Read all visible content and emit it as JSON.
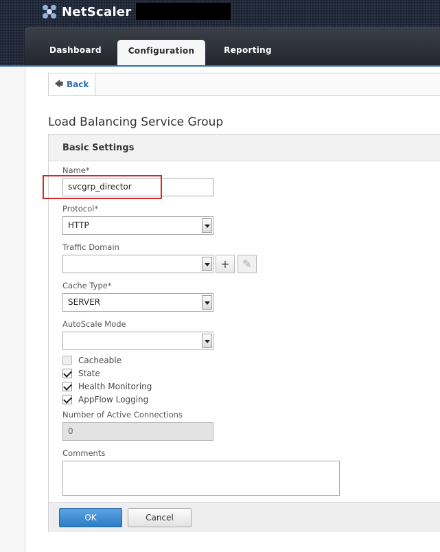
{
  "header": {
    "brand": "NetScaler",
    "tabs": [
      {
        "label": "Dashboard",
        "active": false
      },
      {
        "label": "Configuration",
        "active": true
      },
      {
        "label": "Reporting",
        "active": false
      }
    ]
  },
  "nav": {
    "back_label": "Back"
  },
  "page": {
    "title": "Load Balancing Service Group"
  },
  "panel": {
    "header": "Basic Settings",
    "name": {
      "label": "Name*",
      "value": "svcgrp_director"
    },
    "protocol": {
      "label": "Protocol*",
      "value": "HTTP"
    },
    "traffic_domain": {
      "label": "Traffic Domain",
      "value": ""
    },
    "cache_type": {
      "label": "Cache Type*",
      "value": "SERVER"
    },
    "autoscale": {
      "label": "AutoScale Mode",
      "value": ""
    },
    "checkboxes": [
      {
        "label": "Cacheable",
        "checked": false
      },
      {
        "label": "State",
        "checked": true
      },
      {
        "label": "Health Monitoring",
        "checked": true
      },
      {
        "label": "AppFlow Logging",
        "checked": true
      }
    ],
    "active_connections": {
      "label": "Number of Active Connections",
      "value": "0"
    },
    "comments": {
      "label": "Comments",
      "value": ""
    },
    "ok_label": "OK",
    "cancel_label": "Cancel"
  },
  "colors": {
    "accent": "#2b7cc7",
    "highlight": "#d6252a",
    "header_bg": "#1d2433"
  },
  "icons": [
    "netscaler-logo-icon",
    "back-arrow-icon",
    "plus-icon",
    "pencil-icon",
    "chevron-down-icon",
    "checkmark-icon"
  ]
}
